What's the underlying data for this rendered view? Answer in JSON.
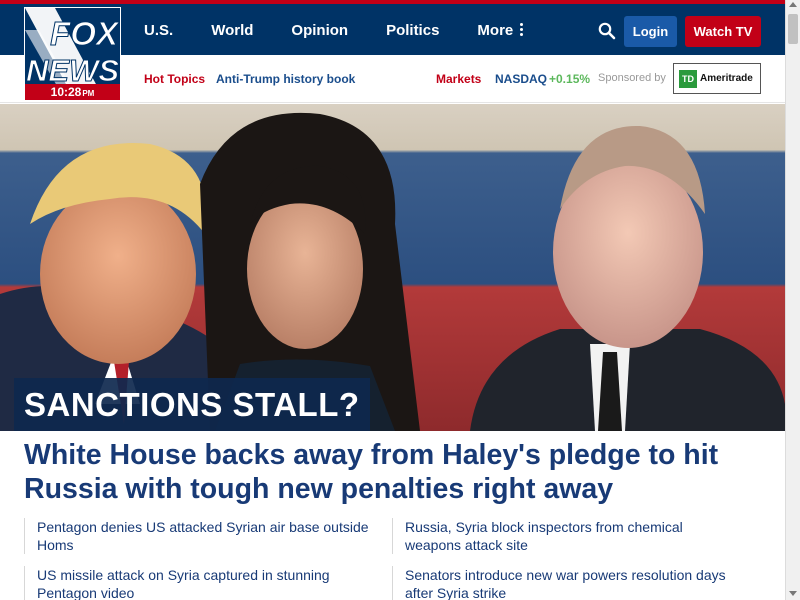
{
  "logo": {
    "line1": "FOX",
    "line2": "NEWS",
    "time": "10:28",
    "ampm": "PM"
  },
  "nav": {
    "items": [
      {
        "label": "U.S."
      },
      {
        "label": "World"
      },
      {
        "label": "Opinion"
      },
      {
        "label": "Politics"
      },
      {
        "label": "More"
      }
    ]
  },
  "header": {
    "login_label": "Login",
    "watch_label": "Watch TV",
    "search_icon": "search-icon"
  },
  "subbar": {
    "hot_topics_label": "Hot Topics",
    "hot_topic_item": "Anti-Trump history book",
    "markets_label": "Markets",
    "nasdaq_label": "NASDAQ",
    "nasdaq_change": "+0.15%",
    "sponsored_label": "Sponsored by",
    "sponsor_logo": "TD Ameritrade"
  },
  "hero": {
    "kicker": "SANCTIONS STALL?"
  },
  "headline": "White House backs away from Haley's pledge to hit Russia with tough new penalties right away",
  "related": [
    {
      "text": "Pentagon denies US attacked Syrian air base outside Homs"
    },
    {
      "text": "Russia, Syria block inspectors from chemical weapons attack site"
    },
    {
      "text": "US missile attack on Syria captured in stunning Pentagon video"
    },
    {
      "text": "Senators introduce new war powers resolution days after Syria strike"
    }
  ],
  "colors": {
    "navy": "#003366",
    "red": "#c20017",
    "headline_blue": "#183a76",
    "green": "#5cb85c"
  }
}
